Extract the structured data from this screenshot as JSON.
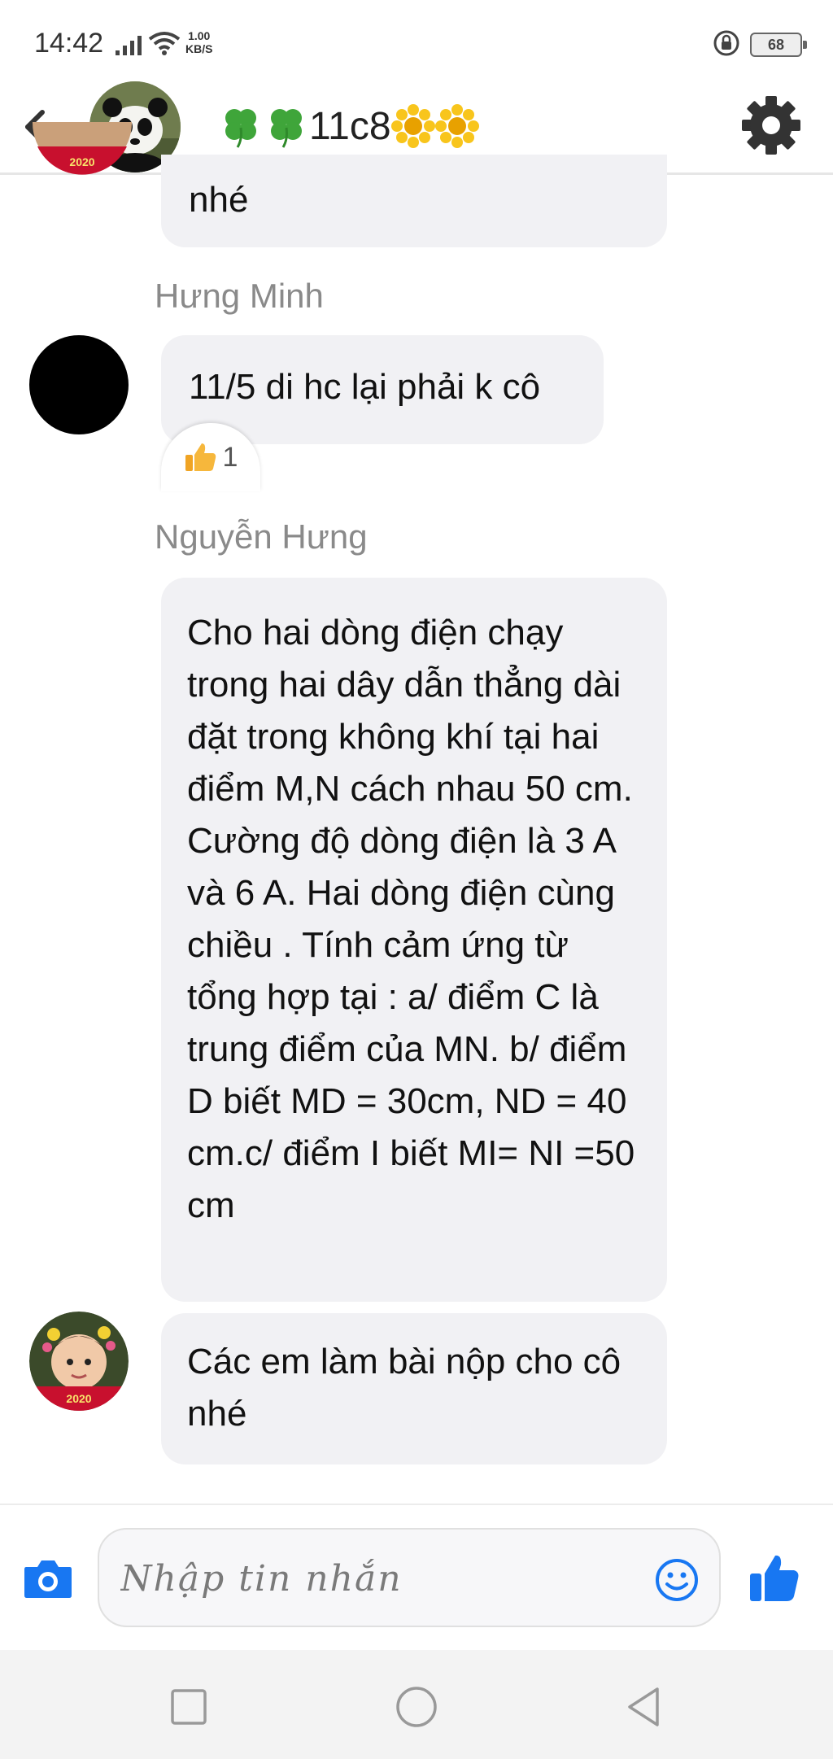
{
  "status_bar": {
    "time": "14:42",
    "net_speed_value": "1.00",
    "net_speed_unit": "KB/S",
    "battery": "68"
  },
  "header": {
    "title": "11c8"
  },
  "messages": [
    {
      "text": "nhé"
    },
    {
      "sender": "Hưng Minh",
      "text": "11/5 di hc lại phải k cô",
      "reaction_count": "1"
    },
    {
      "sender": "Nguyễn Hưng",
      "text": "Cho hai dòng điện chạy trong hai dây dẫn thẳng dài đặt trong không khí tại hai điểm M,N cách nhau 50 cm. Cường độ dòng điện là 3 A và 6 A. Hai dòng điện cùng chiều . Tính cảm ứng từ tổng hợp tại : a/ điểm C là trung điểm của MN. b/ điểm D biết MD = 30cm, ND = 40 cm.c/ điểm I biết MI= NI =50 cm"
    },
    {
      "text": "Các em làm bài nộp cho cô nhé"
    }
  ],
  "avatar_badge": "2020",
  "composer": {
    "placeholder": "Nhập tin nhắn"
  },
  "colors": {
    "accent": "#1877f2",
    "bubble": "#f1f1f4",
    "sender": "#8a8a8a"
  }
}
